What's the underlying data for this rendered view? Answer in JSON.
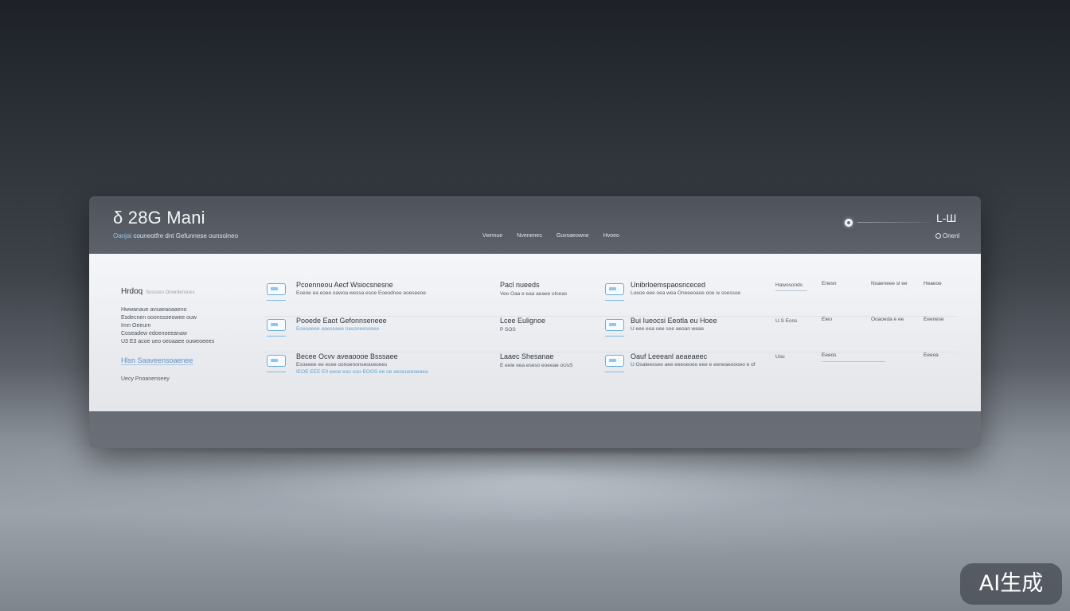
{
  "app": {
    "brand_glyph": "δ",
    "title": "28G Mani",
    "subtitle_accent": "Oanjai",
    "subtitle_rest": "couneotfre dnt Gefunnese ounsoineo"
  },
  "nav": {
    "items": [
      {
        "label": "Vwnnue"
      },
      {
        "label": "Nvenenes"
      },
      {
        "label": "Guvsaeowne"
      },
      {
        "label": "Hvoeo"
      }
    ]
  },
  "top_right": {
    "code": "L-Ш",
    "action_label": "Onenl"
  },
  "sidebar": {
    "heading": "Hrdoq",
    "heading_faint": "Ssssseo Oowrdensnes",
    "lines": [
      "Hwwanaue avsaeaoaaeno",
      "Esdecnen ooonssoeowee ouw",
      "Irnn Oeeurn",
      "Coseadew edoenoeeanaw",
      "U3 E3 acoe ueo oeoaaee ouweoeees"
    ],
    "link_primary": "Hlsn Saaveensoaenee",
    "footer": "Uecy Pnoanenseey"
  },
  "rows": [
    {
      "card1": {
        "title": "Pcoenneou Aecf Wsiocsnesne",
        "meta": "Eoeoe ea eoee oawoa wessa esoe Eoeodnee eoeseeoe",
        "meta2": ""
      },
      "mid": {
        "title": "Pacl nueeds",
        "meta": "Vee Oaa e eaa aeaee oloeas"
      },
      "card2": {
        "title": "Unibrloemspaosnceced",
        "meta": "Loeoe eee oea wea Oneeeoaoe ooe w soessoe",
        "meta2": ""
      },
      "value": "Hawosonds",
      "col_a": "Enesn",
      "col_b": "Noaeneee sl ee",
      "col_c": "Heaeoe"
    },
    {
      "card1": {
        "title": "Pooede Eaot Gefonnseneee",
        "meta": "",
        "meta2": "Eoeoaeee eaeseaee nasoneesseee"
      },
      "mid": {
        "title": "Lcee Eulignoe",
        "meta": "P SOS"
      },
      "card2": {
        "title": "Bui Iueocsi Eeotla eu Hoee",
        "meta": "U eee eoa oee soe aeoan weae",
        "meta2": ""
      },
      "value": "U.S Eoss",
      "col_a": "Eieo",
      "col_b": "Ooaoeda e ee",
      "col_c": "Eeenese"
    },
    {
      "card1": {
        "title": "Becee Ocvv aveaoooe Bsssaee",
        "meta": "Esoeeee ee ecee oonoenonseouwoees",
        "meta2": "IEOE EEE E0 eeoe eoo ooo EOOS ee oe aeoeueeoeaea"
      },
      "mid": {
        "title": "Laaec Shesanae",
        "meta": "E eeie eea eseso eoeeae oUsS"
      },
      "card2": {
        "title": "Oauf Leeeanl aeaeaeec",
        "meta": "U Osaleessee aee eeeoeoeo eee e eeneaeoooeo e of",
        "meta2": ""
      },
      "value": "Usu",
      "col_a": "Eeeos",
      "col_b": "",
      "col_c": "Eeeoa"
    }
  ],
  "watermark": {
    "text": "AI生成"
  }
}
